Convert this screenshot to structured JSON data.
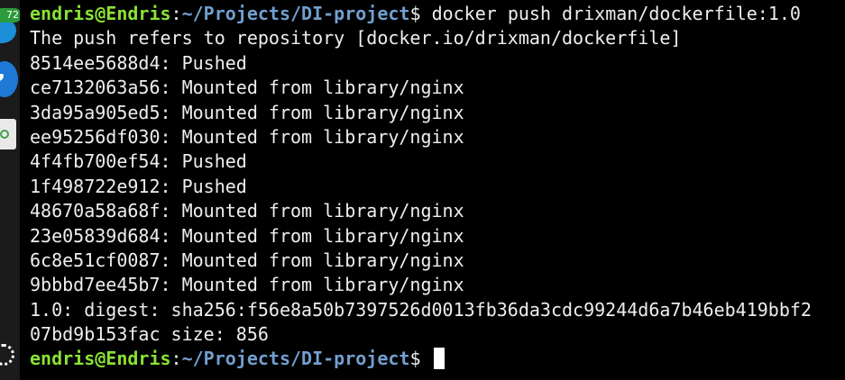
{
  "dock": {
    "badge_count": "72"
  },
  "terminal": {
    "prompt_user": "endris@Endris",
    "prompt_colon": ":",
    "prompt_path": "~/Projects/DI-project",
    "prompt_symbol": "$ ",
    "command": "docker push drixman/dockerfile:1.0",
    "output": [
      "The push refers to repository [docker.io/drixman/dockerfile]",
      "8514ee5688d4: Pushed",
      "ce7132063a56: Mounted from library/nginx",
      "3da95a905ed5: Mounted from library/nginx",
      "ee95256df030: Mounted from library/nginx",
      "4f4fb700ef54: Pushed",
      "1f498722e912: Pushed",
      "48670a58a68f: Mounted from library/nginx",
      "23e05839d684: Mounted from library/nginx",
      "6c8e51cf0087: Mounted from library/nginx",
      "9bbbd7ee45b7: Mounted from library/nginx",
      "1.0: digest: sha256:f56e8a50b7397526d0013fb36da3cdc99244d6a7b46eb419bbf2",
      "07bd9b153fac size: 856"
    ],
    "colors": {
      "background": "#000000",
      "text": "#eeeeec",
      "user": "#8ae234",
      "path": "#729fcf"
    }
  }
}
